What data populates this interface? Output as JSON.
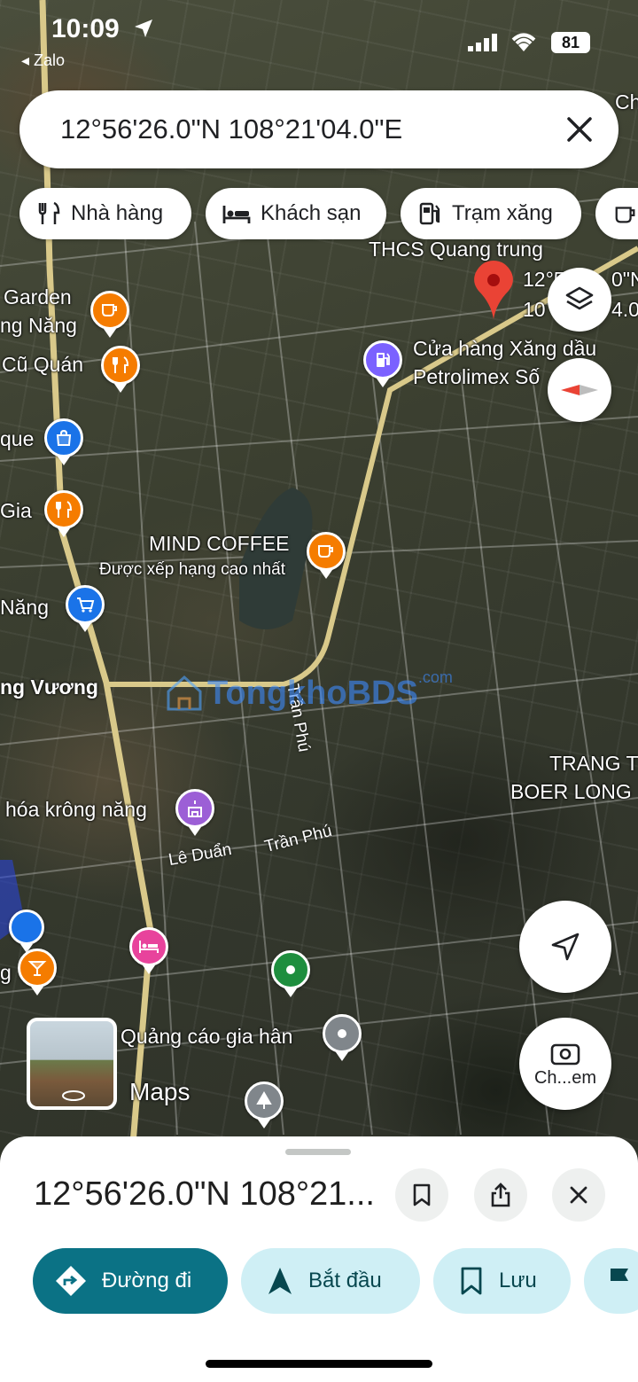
{
  "status_bar": {
    "time": "10:09",
    "back_app": "◂ Zalo",
    "battery": "81"
  },
  "search": {
    "query": "12°56'26.0\"N 108°21'04.0\"E"
  },
  "chips": [
    {
      "label": "Nhà hàng",
      "icon": "restaurant-icon"
    },
    {
      "label": "Khách sạn",
      "icon": "hotel-icon"
    },
    {
      "label": "Trạm xăng",
      "icon": "gas-station-icon"
    }
  ],
  "map": {
    "places": {
      "garden": "Garden",
      "nang1": "ng Năng",
      "cu_quan": "Cũ Quán",
      "que": "que",
      "gia": "Gia",
      "nang2": "Năng",
      "vuong": "ng Vương",
      "mind_coffee": "MIND COFFEE",
      "mind_sub": "Được xếp hạng cao nhất",
      "thcs": "THCS Quang trung",
      "coord_line1": "12°5",
      "coord_line1b": "0\"N",
      "coord_line2": "10",
      "coord_line2b": "4.0\"",
      "petrolimex1": "Cửa hàng Xăng dầu",
      "petrolimex2": "Petrolimex Số",
      "trang1": "TRANG T",
      "trang2": "BOER LONG",
      "van_hoa": "hóa krông năng",
      "quang_cao": "Quảng cáo gia hân",
      "g": "g",
      "ch_top": "Ch",
      "maps": "Maps"
    },
    "roads": {
      "tran_phu_1": "Trần Phú",
      "tran_phu_2": "Trần Phú",
      "le_duan": "Lê Duẩn"
    },
    "watermark": "TongkhoBDS",
    "watermark_com": ".com",
    "camera_label": "Ch...em"
  },
  "sheet": {
    "title": "12°56'26.0\"N 108°21...",
    "actions": [
      {
        "label": "Đường đi"
      },
      {
        "label": "Bắt đầu"
      },
      {
        "label": "Lưu"
      }
    ]
  },
  "colors": {
    "primary": "#0b7285",
    "secondary_bg": "#cfeff5",
    "pin_red": "#ea4335",
    "orange": "#f57c00",
    "blue": "#1a73e8",
    "purple": "#9c5fd6",
    "pink": "#e8439c",
    "green": "#1e8e3e"
  }
}
